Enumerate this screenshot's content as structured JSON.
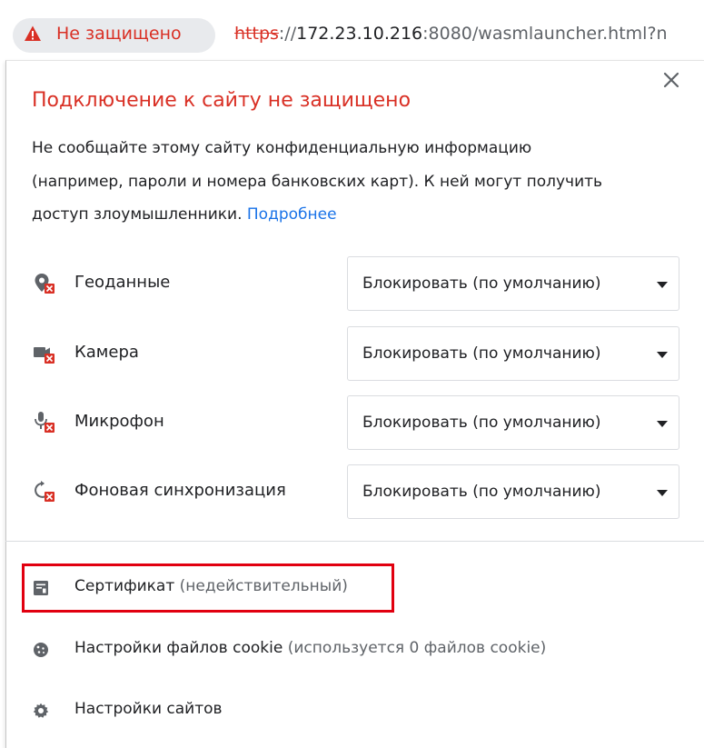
{
  "addressbar": {
    "security_chip": "Не защищено",
    "url_scheme": "https",
    "url_sep": "://",
    "url_host": "172.23.10.216",
    "url_rest": ":8080/wasmlauncher.html?n"
  },
  "popup": {
    "title": "Подключение к сайту не защищено",
    "desc_line1": "Не сообщайте этому сайту конфиденциальную информацию",
    "desc_line2": "(например, пароли и номера банковских карт). К ней могут получить",
    "desc_line3": "доступ злоумышленники.",
    "more_link": "Подробнее",
    "permissions": [
      {
        "label": "Геоданные",
        "value": "Блокировать (по умолчанию)",
        "icon": "location-blocked-icon"
      },
      {
        "label": "Камера",
        "value": "Блокировать (по умолчанию)",
        "icon": "camera-blocked-icon"
      },
      {
        "label": "Микрофон",
        "value": "Блокировать (по умолчанию)",
        "icon": "microphone-blocked-icon"
      },
      {
        "label": "Фоновая синхронизация",
        "value": "Блокировать (по умолчанию)",
        "icon": "sync-blocked-icon"
      }
    ],
    "certificate": {
      "label": "Сертификат",
      "sub": "(недействительный)"
    },
    "cookies": {
      "label": "Настройки файлов cookie",
      "sub": "(используется 0 файлов cookie)"
    },
    "site_settings": {
      "label": "Настройки сайтов"
    }
  },
  "colors": {
    "danger": "#d93025",
    "link": "#1a73e8",
    "highlight": "#e1000f"
  }
}
